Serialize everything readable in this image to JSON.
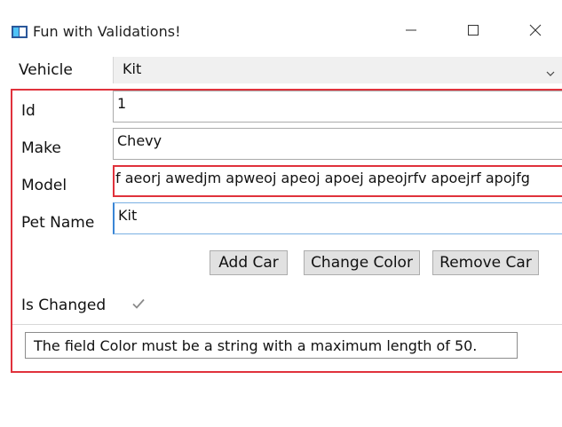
{
  "window": {
    "title": "Fun with Validations!",
    "icons": {
      "app": "app-window-icon",
      "minimize": "minimize-icon",
      "maximize": "maximize-icon",
      "close": "close-icon"
    }
  },
  "form": {
    "vehicle_label": "Vehicle",
    "vehicle_value": "Kit",
    "id_label": "Id",
    "id_value": "1",
    "make_label": "Make",
    "make_value": "Chevy",
    "model_label": "Model",
    "model_value": "f aeorj awedjm apweoj apeoj apoej apeojrfv apoejrf apojfg",
    "petname_label": "Pet Name",
    "petname_value": "Kit",
    "is_changed_label": "Is Changed",
    "is_changed_checked": true
  },
  "buttons": {
    "add_car": "Add Car",
    "change_color": "Change Color",
    "remove_car": "Remove Car"
  },
  "validation": {
    "error_message": "The field Color must be a string with a maximum length of 50.",
    "error_color": "#e0323c"
  },
  "colors": {
    "button_bg": "#e1e1e1",
    "combo_bg": "#f0f0f0",
    "focus_border": "#3a86d6"
  }
}
